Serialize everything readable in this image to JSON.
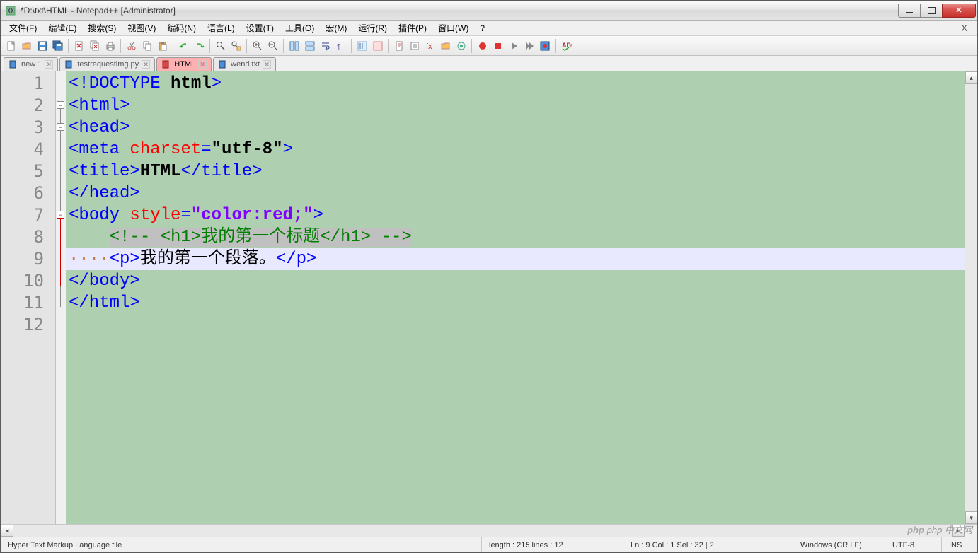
{
  "title": "*D:\\txt\\HTML - Notepad++ [Administrator]",
  "menu": [
    "文件(F)",
    "编辑(E)",
    "搜索(S)",
    "视图(V)",
    "编码(N)",
    "语言(L)",
    "设置(T)",
    "工具(O)",
    "宏(M)",
    "运行(R)",
    "插件(P)",
    "窗口(W)",
    "?"
  ],
  "tabs": [
    {
      "label": "new 1",
      "active": false,
      "icon": "blue"
    },
    {
      "label": "testrequestimg.py",
      "active": false,
      "icon": "blue"
    },
    {
      "label": "HTML",
      "active": true,
      "icon": "red"
    },
    {
      "label": "wend.txt",
      "active": false,
      "icon": "blue"
    }
  ],
  "gutter": [
    "1",
    "2",
    "3",
    "4",
    "5",
    "6",
    "7",
    "8",
    "9",
    "10",
    "11",
    "12"
  ],
  "code": {
    "l1": {
      "a": "<!DOCTYPE ",
      "b": "html",
      "c": ">"
    },
    "l2": {
      "a": "<html>"
    },
    "l3": {
      "a": "<head>"
    },
    "l4": {
      "a": "<meta ",
      "b": "charset",
      "c": "=",
      "d": "\"utf-8\"",
      "e": ">"
    },
    "l5": {
      "a": "<title>",
      "b": "HTML",
      "c": "</title>"
    },
    "l6": {
      "a": "</head>"
    },
    "l7": {
      "a": "<body ",
      "b": "style",
      "c": "=",
      "d": "\"color:red;\"",
      "e": ">"
    },
    "l8": {
      "a": "    ",
      "b": "<!-- <h1>我的第一个标题</h1> -->"
    },
    "l9": {
      "a": "····",
      "b": "<p>",
      "c": "我的第一个段落。",
      "d": "</p>"
    },
    "l10": {
      "a": "</body>"
    },
    "l11": {
      "a": "</html>"
    }
  },
  "status": {
    "lang": "Hyper Text Markup Language file",
    "length": "length : 215    lines : 12",
    "pos": "Ln : 9    Col : 1    Sel : 32 | 2",
    "eol": "Windows (CR LF)",
    "enc": "UTF-8",
    "ins": "INS"
  },
  "watermark": "php 中文网"
}
